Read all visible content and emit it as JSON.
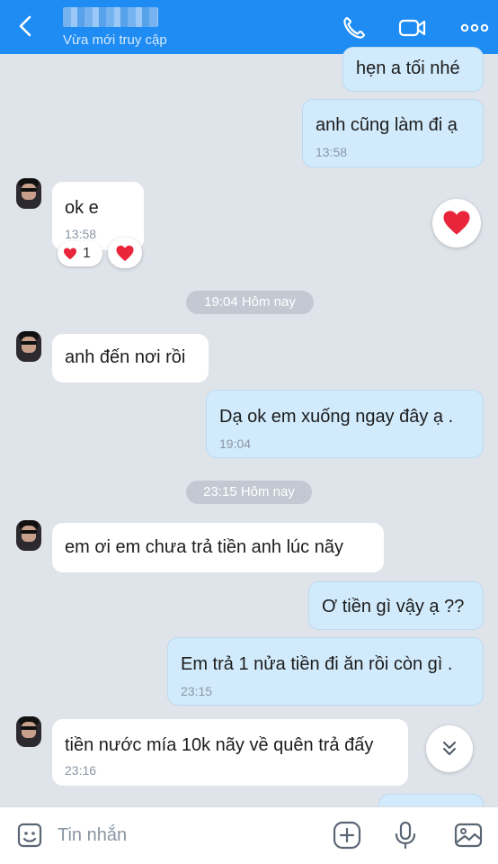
{
  "header": {
    "status": "Vừa mới truy cập"
  },
  "messages": {
    "m1": {
      "text": "hẹn a tối nhé"
    },
    "m2": {
      "text": "anh cũng làm đi ạ",
      "time": "13:58"
    },
    "m3": {
      "text": "ok e",
      "time": "13:58",
      "reaction_count": "1"
    },
    "sep1": "19:04 Hôm nay",
    "m4": {
      "text": "anh đến nơi rồi"
    },
    "m5": {
      "text": "Dạ ok em xuống ngay đây ạ .",
      "time": "19:04"
    },
    "sep2": "23:15 Hôm nay",
    "m6": {
      "text": "em ơi em chưa trả tiền anh lúc nãy"
    },
    "m7": {
      "text": "Ơ tiền gì vậy ạ ??"
    },
    "m8": {
      "text": "Em trả 1 nửa tiền đi ăn rồi còn gì .",
      "time": "23:15"
    },
    "m9": {
      "text": "tiền nước mía 10k nãy về quên trả đấy",
      "time": "23:16"
    }
  },
  "composer": {
    "placeholder": "Tin nhắn"
  },
  "colors": {
    "header_bg": "#1e8cf3",
    "chat_bg": "#dfe3ea",
    "outgoing_bubble": "#d2ebfc",
    "incoming_bubble": "#ffffff",
    "heart": "#e8253a",
    "icon_blue": "#1e8cf3"
  },
  "icons": [
    "back-chevron-icon",
    "phone-icon",
    "video-call-icon",
    "more-icon",
    "heart-icon",
    "scroll-down-icon",
    "sticker-icon",
    "plus-icon",
    "microphone-icon",
    "image-icon"
  ]
}
